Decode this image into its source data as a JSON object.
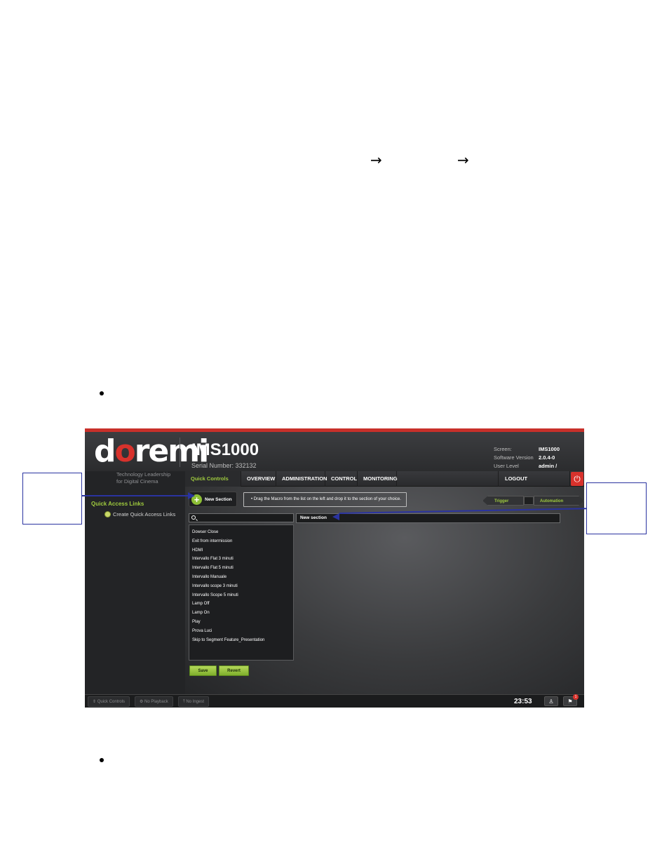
{
  "document": {
    "arrow_1": "→",
    "arrow_2": "→"
  },
  "screenshot": {
    "logo": {
      "prefix": "d",
      "o": "o",
      "suffix": "remi"
    },
    "product": "IMS1000",
    "serial": "Serial Number: 332132",
    "info_labels": [
      "Screen:",
      "Software Version",
      "User Level"
    ],
    "info_values": [
      "IMS1000",
      "2.0.4-0",
      "admin / SuperUser"
    ],
    "tagline": [
      "Technology Leadership",
      "for Digital Cinema"
    ],
    "sidebar": {
      "title": "Quick Access Links",
      "link": "Create Quick Access Links"
    },
    "nav": {
      "quick_controls": "Quick Controls",
      "overview": "OVERVIEW",
      "administration": "ADMINISTRATION",
      "control": "CONTROL",
      "monitoring": "MONITORING",
      "logout": "LOGOUT"
    },
    "new_section_button": "New Section",
    "hint": "•  Drag the Macro from the list on the left and drop it to the section of your choice.",
    "trigger_cue": "Trigger Cue",
    "automation_cue": "Automation Cue",
    "section_header": "New section",
    "macros": [
      "Dowser Close",
      "Exit from intermission",
      "HDMI",
      "Intervallo Flat 3 minuti",
      "Intervallo Flat 5 minuti",
      "Intervallo Manuale",
      "Intervallo scope 3 minuti",
      "Intervallo Scope 5 minuti",
      "Lamp Off",
      "Lamp On",
      "Play",
      "Prova Luci",
      "Skip to Segment Feature_Presentation"
    ],
    "save": "Save",
    "revert": "Revert",
    "status": {
      "quick_controls": "Quick Controls",
      "no_playback": "No Playback",
      "no_ingest": "No Ingest",
      "clock": "23:53",
      "badge": "1"
    }
  },
  "colors": {
    "callout": "#2a33a0",
    "accent_green": "#9fcb3e",
    "brand_red": "#d8322c"
  }
}
